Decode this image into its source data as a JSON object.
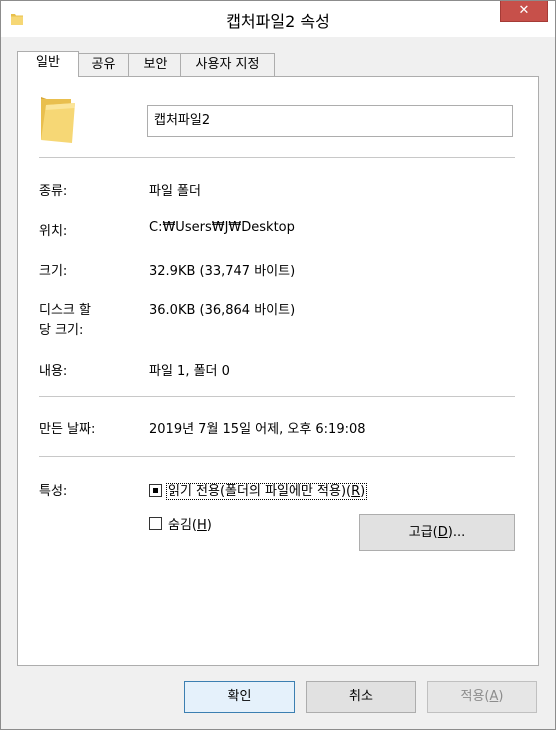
{
  "window": {
    "title": "캡처파일2 속성",
    "close_glyph": "✕"
  },
  "tabs": [
    {
      "label": "일반"
    },
    {
      "label": "공유"
    },
    {
      "label": "보안"
    },
    {
      "label": "사용자 지정"
    }
  ],
  "general": {
    "name_value": "캡처파일2",
    "type_label": "종류:",
    "type_value": "파일 폴더",
    "location_label": "위치:",
    "location_value": "C:₩Users₩J₩Desktop",
    "size_label": "크기:",
    "size_value": "32.9KB (33,747 바이트)",
    "disk_size_label_line1": "디스크 할",
    "disk_size_label_line2": "당 크기:",
    "disk_size_value": "36.0KB (36,864 바이트)",
    "contains_label": "내용:",
    "contains_value": "파일 1, 폴더 0",
    "created_label": "만든 날짜:",
    "created_value": "2019년 7월 15일 어제, 오후 6:19:08",
    "attributes_label": "특성:",
    "readonly_text": "읽기 전용(폴더의 파일에만 적용)(",
    "readonly_key": "R",
    "readonly_end": ")",
    "readonly_state": "indeterminate",
    "hidden_text": "숨김(",
    "hidden_key": "H",
    "hidden_end": ")",
    "hidden_checked": false,
    "advanced_text": "고급(",
    "advanced_key": "D",
    "advanced_end": ")..."
  },
  "footer": {
    "ok_label": "확인",
    "cancel_label": "취소",
    "apply_text": "적용(",
    "apply_key": "A",
    "apply_end": ")"
  },
  "colors": {
    "close_button": "#c7504a",
    "folder_yellow": "#f4d26a",
    "default_button_border": "#3c7fb1"
  },
  "icons": {
    "title": "folder-icon",
    "big": "folder-icon",
    "close": "close-icon"
  }
}
